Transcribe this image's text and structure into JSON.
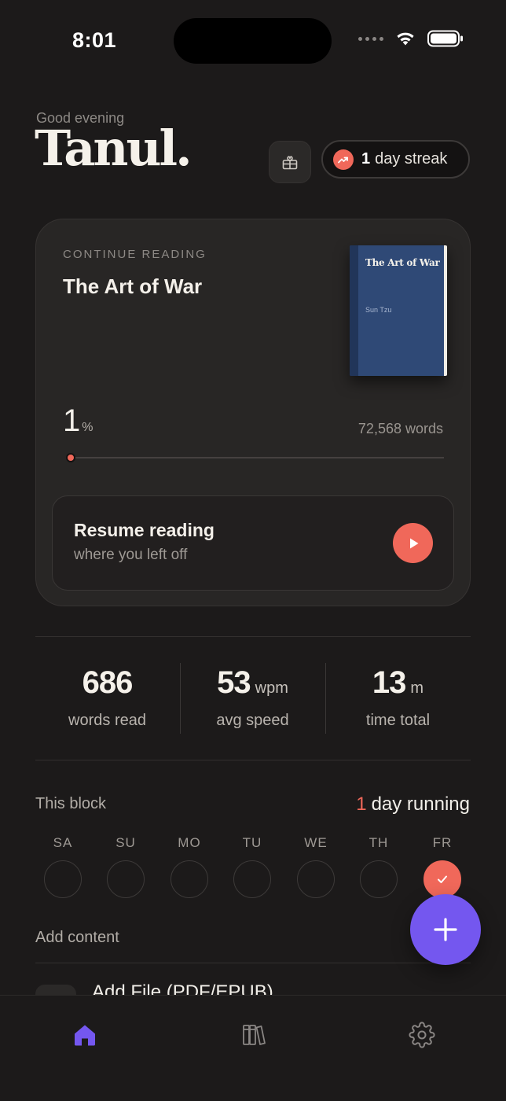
{
  "status_bar": {
    "time": "8:01"
  },
  "header": {
    "greeting": "Good evening",
    "name": "Tanul.",
    "gift_icon": "gift-icon",
    "streak": {
      "count": "1",
      "label": "day streak",
      "icon": "trending-up-icon"
    }
  },
  "continue_card": {
    "eyebrow": "CONTINUE READING",
    "title": "The Art of War",
    "cover": {
      "title": "The Art of War",
      "author": "Sun Tzu",
      "color": "#2f4976"
    },
    "progress_value": "1",
    "progress_unit": "%",
    "progress_fraction": 0.01,
    "word_count": "72,568 words",
    "resume": {
      "title": "Resume reading",
      "subtitle": "where you left off",
      "icon": "play-icon"
    }
  },
  "stats": [
    {
      "value": "686",
      "unit": "",
      "label": "words read"
    },
    {
      "value": "53",
      "unit": "wpm",
      "label": "avg speed"
    },
    {
      "value": "13",
      "unit": "m",
      "label": "time total"
    }
  ],
  "block": {
    "title": "This block",
    "running_count": "1",
    "running_label": "day running",
    "days": [
      {
        "label": "SA",
        "done": false
      },
      {
        "label": "SU",
        "done": false
      },
      {
        "label": "MO",
        "done": false
      },
      {
        "label": "TU",
        "done": false
      },
      {
        "label": "WE",
        "done": false
      },
      {
        "label": "TH",
        "done": false
      },
      {
        "label": "FR",
        "done": true
      }
    ]
  },
  "add_content": {
    "title": "Add content",
    "first_item": "Add File (PDF/EPUB)",
    "fab_icon": "plus-icon"
  },
  "nav": [
    {
      "name": "home",
      "icon": "home-icon",
      "active": true
    },
    {
      "name": "library",
      "icon": "library-icon",
      "active": false
    },
    {
      "name": "settings",
      "icon": "gear-icon",
      "active": false
    }
  ],
  "colors": {
    "accent": "#f0685a",
    "primary": "#7457ef",
    "background": "#1c1a1a"
  }
}
